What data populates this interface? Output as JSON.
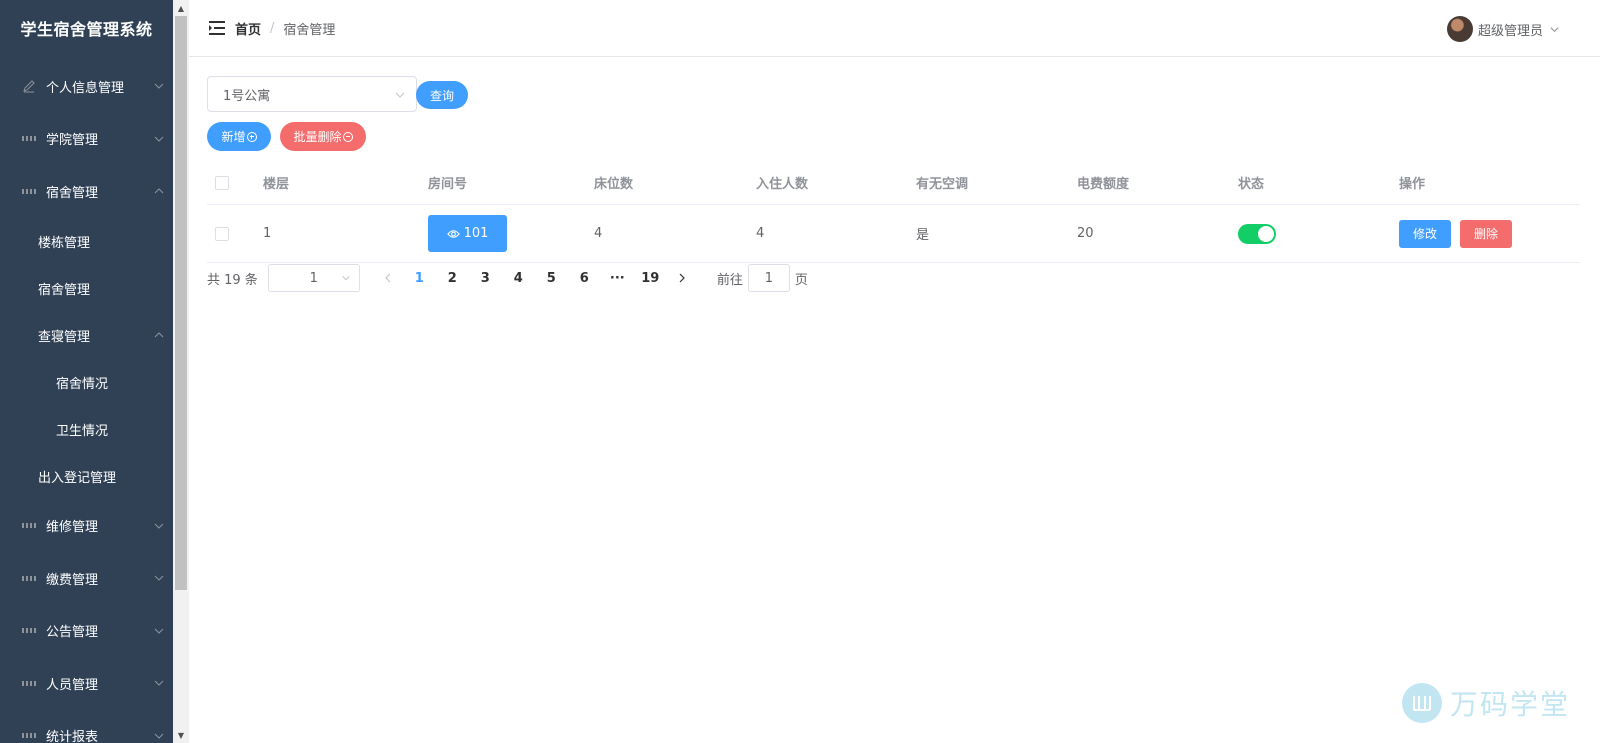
{
  "app": {
    "title": "学生宿舍管理系统"
  },
  "sidebar": {
    "items": [
      {
        "label": "个人信息管理",
        "icon": "edit-icon"
      },
      {
        "label": "学院管理",
        "icon": "grid-icon"
      },
      {
        "label": "宿舍管理",
        "icon": "grid-icon",
        "expanded": true,
        "children": [
          {
            "label": "楼栋管理"
          },
          {
            "label": "宿舍管理"
          },
          {
            "label": "查寝管理",
            "expanded": true,
            "children": [
              {
                "label": "宿舍情况"
              },
              {
                "label": "卫生情况"
              }
            ]
          },
          {
            "label": "出入登记管理"
          }
        ]
      },
      {
        "label": "维修管理",
        "icon": "grid-icon"
      },
      {
        "label": "缴费管理",
        "icon": "grid-icon"
      },
      {
        "label": "公告管理",
        "icon": "grid-icon"
      },
      {
        "label": "人员管理",
        "icon": "grid-icon"
      },
      {
        "label": "统计报表",
        "icon": "grid-icon"
      }
    ]
  },
  "header": {
    "breadcrumb": {
      "home": "首页",
      "separator": "/",
      "current": "宿舍管理"
    },
    "user": {
      "name": "超级管理员"
    }
  },
  "filter": {
    "building_value": "1号公寓",
    "query_label": "查询",
    "add_label": "新增",
    "batch_delete_label": "批量删除"
  },
  "table": {
    "columns": [
      "楼层",
      "房间号",
      "床位数",
      "入住人数",
      "有无空调",
      "电费额度",
      "状态",
      "操作"
    ],
    "rows": [
      {
        "floor": "1",
        "room": "101",
        "beds": "4",
        "occupants": "4",
        "ac": "是",
        "quota": "20",
        "status_on": true,
        "edit_label": "修改",
        "delete_label": "删除"
      }
    ]
  },
  "pagination": {
    "total_text": "共 19 条",
    "page_size": "1",
    "pages": [
      "1",
      "2",
      "3",
      "4",
      "5",
      "6",
      "···",
      "19"
    ],
    "current": "1",
    "goto_prefix": "前往",
    "goto_value": "1",
    "goto_suffix": "页"
  },
  "watermark": {
    "text": "万码学堂"
  },
  "colors": {
    "sidebar_bg": "#304156",
    "primary": "#409eff",
    "danger": "#f56c6c",
    "success": "#13ce66"
  }
}
